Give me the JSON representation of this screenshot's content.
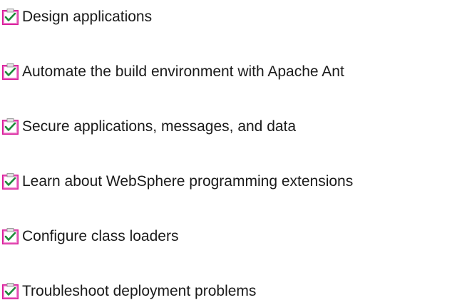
{
  "colors": {
    "clipboard_outer": "#d81b9a",
    "clipboard_inner": "#f08bd0",
    "paper": "#ffffff",
    "clip": "#e0e0e0",
    "check": "#1e8a3a",
    "text": "#1a1a1a"
  },
  "tasks": [
    {
      "label": "Design applications",
      "icon": "task-checklist-icon"
    },
    {
      "label": "Automate the build environment with Apache Ant",
      "icon": "task-checklist-icon"
    },
    {
      "label": "Secure applications, messages, and data",
      "icon": "task-checklist-icon"
    },
    {
      "label": "Learn about WebSphere programming extensions",
      "icon": "task-checklist-icon"
    },
    {
      "label": "Configure class loaders",
      "icon": "task-checklist-icon"
    },
    {
      "label": "Troubleshoot deployment problems",
      "icon": "task-checklist-icon"
    }
  ]
}
